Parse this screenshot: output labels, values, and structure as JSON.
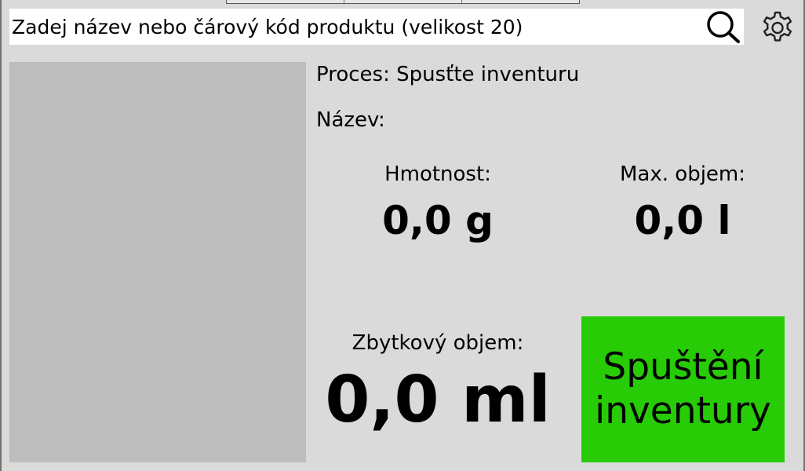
{
  "search": {
    "placeholder": "Zadej název nebo čárový kód produktu (velikost 20)"
  },
  "icons": {
    "search": "search-icon",
    "settings": "gear-icon"
  },
  "info": {
    "process_label": "Proces: Spusťte inventuru",
    "name_label": "Název:"
  },
  "metrics": {
    "weight_label": "Hmotnost:",
    "weight_value": "0,0 g",
    "max_volume_label": "Max. objem:",
    "max_volume_value": "0,0 l",
    "residual_volume_label": "Zbytkový objem:",
    "residual_volume_value": "0,0 ml"
  },
  "actions": {
    "start_line1": "Spuštění",
    "start_line2": "inventury"
  },
  "colors": {
    "background": "#dadada",
    "image_placeholder": "#bdbdbd",
    "start_button": "#27cc06"
  }
}
